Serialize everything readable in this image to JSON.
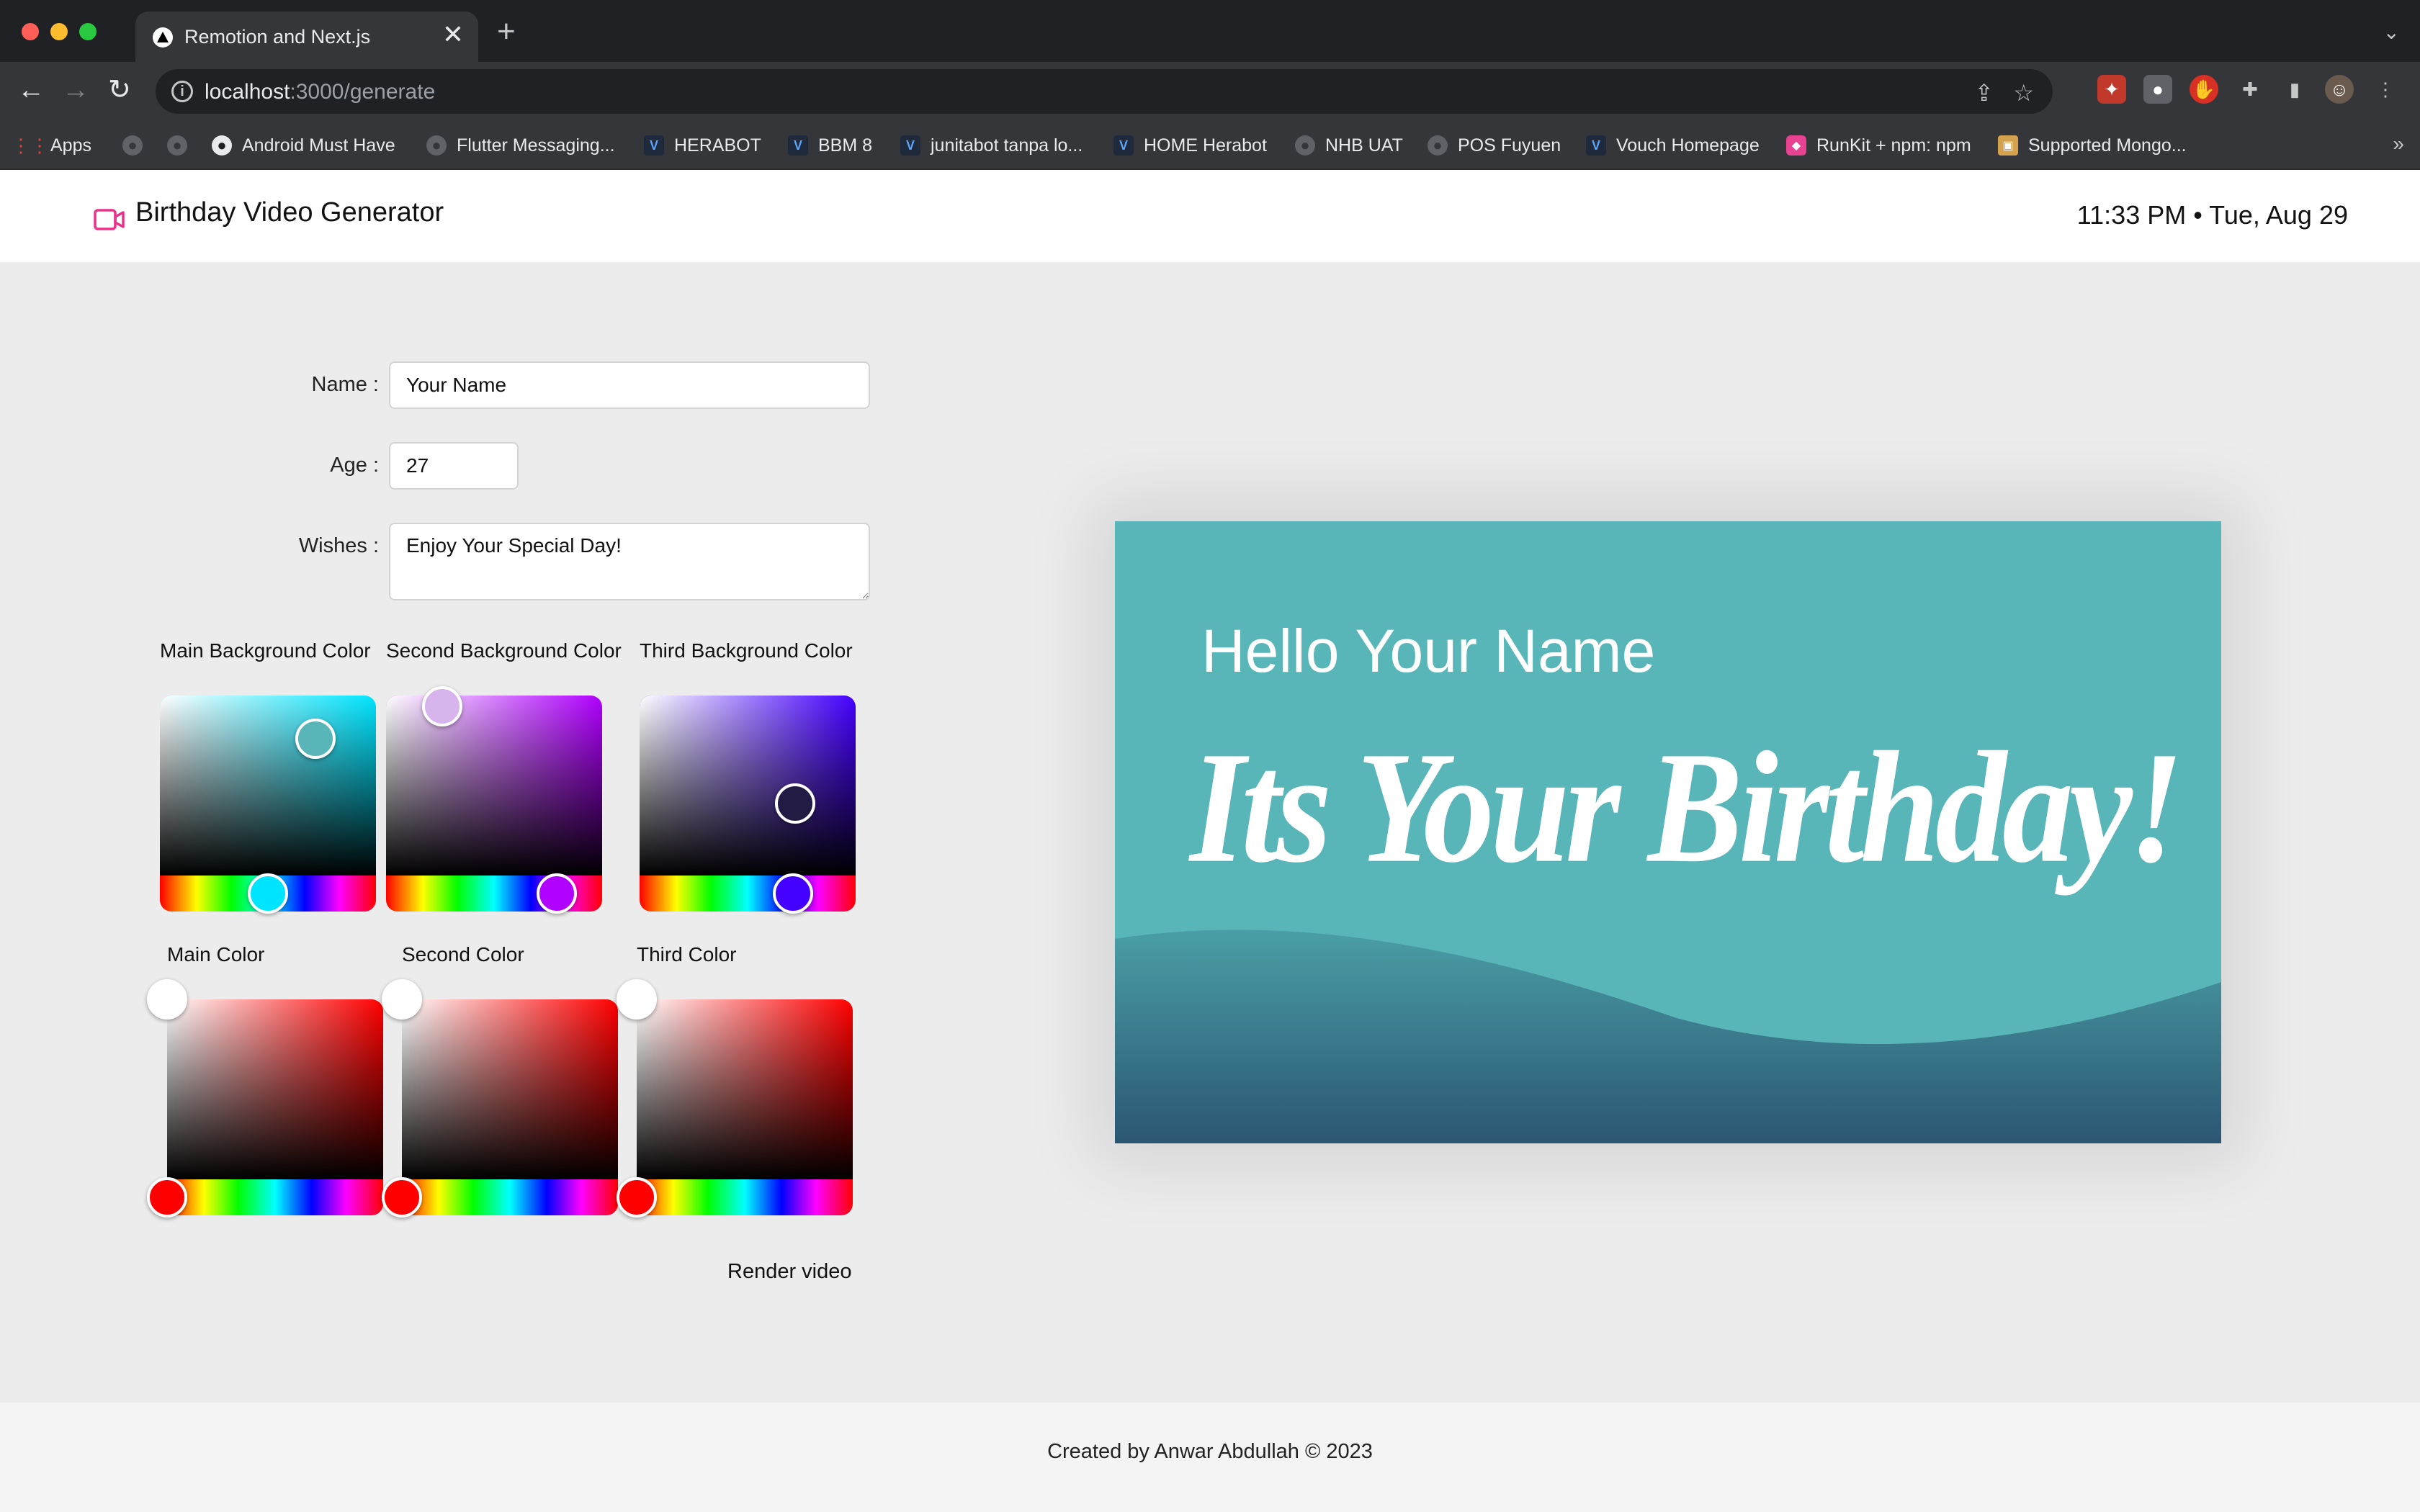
{
  "browser": {
    "tab_title": "Remotion and Next.js",
    "tab_close": "✕",
    "new_tab": "+",
    "url_host": "localhost",
    "url_path": ":3000/generate",
    "bookmarks": [
      {
        "label": "Apps",
        "icon": "apps-grid-icon"
      },
      {
        "label": "",
        "icon": "globe-icon"
      },
      {
        "label": "",
        "icon": "globe-icon"
      },
      {
        "label": "Android Must Have",
        "icon": "github-icon"
      },
      {
        "label": "Flutter Messaging...",
        "icon": "globe-icon"
      },
      {
        "label": "HERABOT",
        "icon": "vuetify-icon"
      },
      {
        "label": "BBM 8",
        "icon": "vuetify-icon"
      },
      {
        "label": "junitabot tanpa lo...",
        "icon": "vuetify-icon"
      },
      {
        "label": "HOME Herabot",
        "icon": "vuetify-icon"
      },
      {
        "label": "NHB UAT",
        "icon": "globe-icon"
      },
      {
        "label": "POS Fuyuen",
        "icon": "globe-icon"
      },
      {
        "label": "Vouch Homepage",
        "icon": "vuetify-icon"
      },
      {
        "label": "RunKit + npm: npm",
        "icon": "runkit-icon"
      },
      {
        "label": "Supported Mongo...",
        "icon": "box-icon"
      }
    ],
    "bookmarks_more": "»"
  },
  "header": {
    "brand": "Birthday Video Generator",
    "clock": "11:33 PM • Tue, Aug 29",
    "logo_color": "#e9338a"
  },
  "form": {
    "name_label": "Name :",
    "name_value": "Your Name",
    "age_label": "Age :",
    "age_value": "27",
    "wishes_label": "Wishes :",
    "wishes_value": "Enjoy Your Special Day!"
  },
  "bg_pickers": [
    {
      "label": "Main Background Color",
      "hue_color": "#00e5ff",
      "hue_fraction": 0.5,
      "thumb_color": "#59b6b8"
    },
    {
      "label": "Second Background Color",
      "hue_color": "#b000ff",
      "hue_fraction": 0.79,
      "thumb_color": "#d7b5ec"
    },
    {
      "label": "Third Background Color",
      "hue_color": "#4400ff",
      "hue_fraction": 0.71,
      "thumb_color": "#221b43"
    }
  ],
  "fg_pickers": [
    {
      "label": "Main Color",
      "hue_color": "#ff0000",
      "hue_fraction": 0.0,
      "thumb_color": "#ffffff"
    },
    {
      "label": "Second Color",
      "hue_color": "#ff0000",
      "hue_fraction": 0.0,
      "thumb_color": "#ffffff"
    },
    {
      "label": "Third Color",
      "hue_color": "#ff0000",
      "hue_fraction": 0.0,
      "thumb_color": "#ffffff"
    }
  ],
  "render_button": "Render video",
  "preview": {
    "hello": "Hello Your Name",
    "headline": "Its Your Birthday!",
    "bg_color": "#59b6b8",
    "wave_color": "#2b5672"
  },
  "footer": {
    "credit": "Created by Anwar Abdullah © 2023"
  }
}
